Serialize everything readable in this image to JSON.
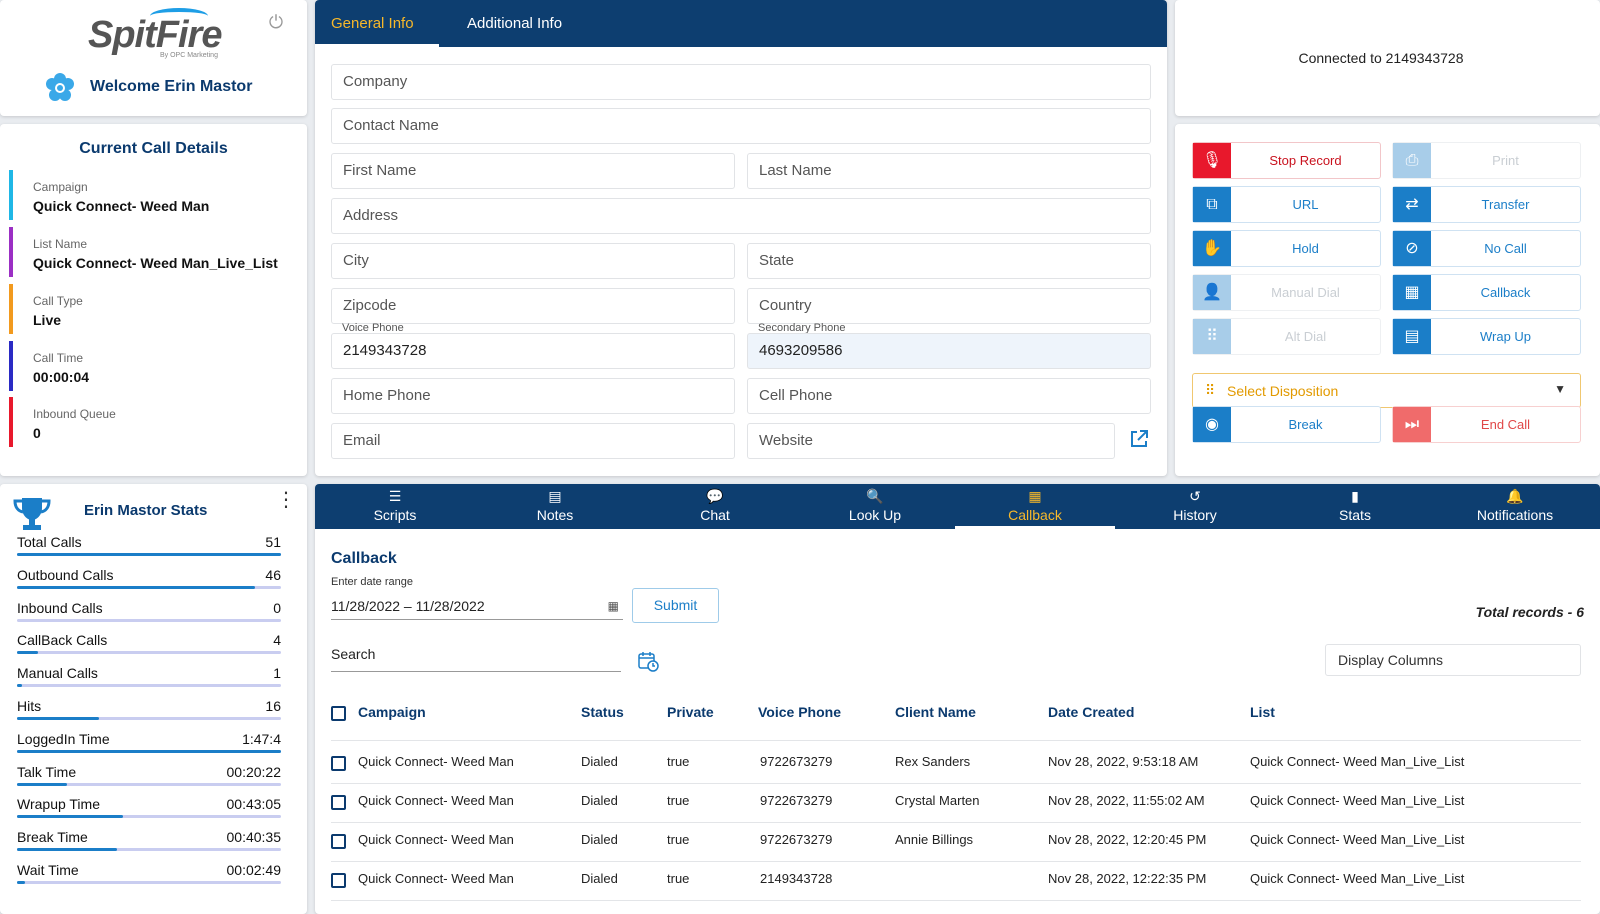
{
  "brand": {
    "logo": "SpitFire",
    "logo_sub": "By OPC Marketing",
    "welcome": "Welcome Erin Mastor"
  },
  "details": {
    "title": "Current Call Details",
    "items": [
      {
        "label": "Campaign",
        "value": "Quick Connect- Weed Man",
        "color": "#1fb7e6"
      },
      {
        "label": "List Name",
        "value": "Quick Connect- Weed Man_Live_List",
        "color": "#9b2fc4"
      },
      {
        "label": "Call Type",
        "value": "Live",
        "color": "#f29a1e"
      },
      {
        "label": "Call Time",
        "value": "00:00:04",
        "color": "#2a2ac4"
      },
      {
        "label": "Inbound Queue",
        "value": "0",
        "color": "#e8182c"
      }
    ]
  },
  "stats": {
    "title": "Erin Mastor Stats",
    "items": [
      {
        "label": "Total Calls",
        "value": "51",
        "fill": 1.0
      },
      {
        "label": "Outbound Calls",
        "value": "46",
        "fill": 0.9
      },
      {
        "label": "Inbound Calls",
        "value": "0",
        "fill": 0.0
      },
      {
        "label": "CallBack Calls",
        "value": "4",
        "fill": 0.08
      },
      {
        "label": "Manual Calls",
        "value": "1",
        "fill": 0.02
      },
      {
        "label": "Hits",
        "value": "16",
        "fill": 0.31
      },
      {
        "label": "LoggedIn Time",
        "value": "1:47:4",
        "fill": 1.0
      },
      {
        "label": "Talk Time",
        "value": "00:20:22",
        "fill": 0.19
      },
      {
        "label": "Wrapup Time",
        "value": "00:43:05",
        "fill": 0.4
      },
      {
        "label": "Break Time",
        "value": "00:40:35",
        "fill": 0.38
      },
      {
        "label": "Wait Time",
        "value": "00:02:49",
        "fill": 0.03
      }
    ]
  },
  "form": {
    "tabs": [
      "General Info",
      "Additional Info"
    ],
    "company": "Company",
    "contact_name": "Contact Name",
    "first_name": "First Name",
    "last_name": "Last Name",
    "address": "Address",
    "city": "City",
    "state": "State",
    "zipcode": "Zipcode",
    "country": "Country",
    "voice_phone_label": "Voice Phone",
    "voice_phone": "2149343728",
    "secondary_phone_label": "Secondary Phone",
    "secondary_phone": "4693209586",
    "home_phone": "Home Phone",
    "cell_phone": "Cell Phone",
    "email": "Email",
    "website": "Website"
  },
  "connection": {
    "text": "Connected to 2149343728"
  },
  "controls": {
    "stop_record": "Stop Record",
    "print": "Print",
    "url": "URL",
    "transfer": "Transfer",
    "hold": "Hold",
    "no_call": "No Call",
    "manual_dial": "Manual Dial",
    "callback": "Callback",
    "alt_dial": "Alt Dial",
    "wrap_up": "Wrap Up",
    "disposition": "Select Disposition",
    "break": "Break",
    "end_call": "End Call"
  },
  "nav": {
    "items": [
      {
        "label": "Scripts",
        "icon": "list-icon"
      },
      {
        "label": "Notes",
        "icon": "document-icon"
      },
      {
        "label": "Chat",
        "icon": "chat-icon"
      },
      {
        "label": "Look Up",
        "icon": "search-icon"
      },
      {
        "label": "Callback",
        "icon": "calendar-icon"
      },
      {
        "label": "History",
        "icon": "history-icon"
      },
      {
        "label": "Stats",
        "icon": "bar-chart-icon"
      },
      {
        "label": "Notifications",
        "icon": "bell-icon"
      }
    ],
    "active": "Callback"
  },
  "callback": {
    "title": "Callback",
    "date_label": "Enter date range",
    "date_range": "11/28/2022 – 11/28/2022",
    "submit": "Submit",
    "total": "Total records - 6",
    "search": "Search",
    "display_columns": "Display Columns",
    "columns": [
      "Campaign",
      "Status",
      "Private",
      "Voice Phone",
      "Client Name",
      "Date Created",
      "List"
    ],
    "rows": [
      [
        "Quick Connect- Weed Man",
        "Dialed",
        "true",
        "9722673279",
        "Rex Sanders",
        "Nov 28, 2022, 9:53:18 AM",
        "Quick Connect- Weed Man_Live_List"
      ],
      [
        "Quick Connect- Weed Man",
        "Dialed",
        "true",
        "9722673279",
        "Crystal Marten",
        "Nov 28, 2022, 11:55:02 AM",
        "Quick Connect- Weed Man_Live_List"
      ],
      [
        "Quick Connect- Weed Man",
        "Dialed",
        "true",
        "9722673279",
        "Annie Billings",
        "Nov 28, 2022, 12:20:45 PM",
        "Quick Connect- Weed Man_Live_List"
      ],
      [
        "Quick Connect- Weed Man",
        "Dialed",
        "true",
        "2149343728",
        "",
        "Nov 28, 2022, 12:22:35 PM",
        "Quick Connect- Weed Man_Live_List"
      ]
    ]
  }
}
